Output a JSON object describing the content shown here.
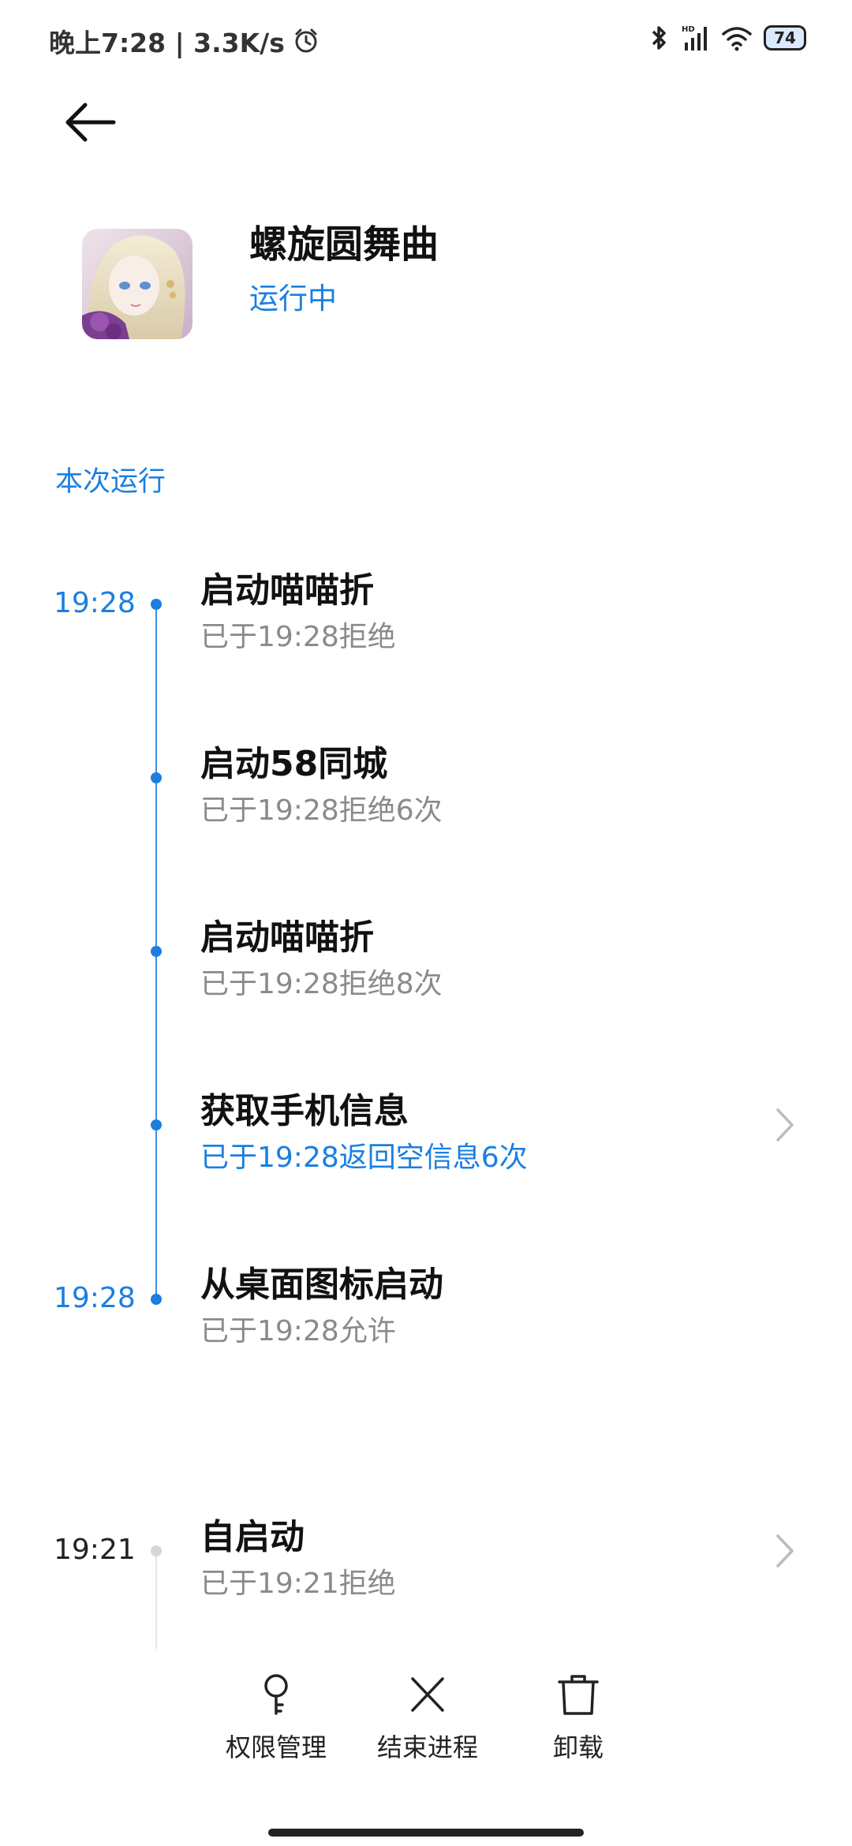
{
  "status_bar": {
    "time": "晚上7:28 | 3.3K/s",
    "battery": "74",
    "icons": [
      "alarm-icon",
      "bluetooth-icon",
      "signal-hd-icon",
      "wifi-icon",
      "battery-icon"
    ]
  },
  "header": {
    "back_icon": "back-arrow-icon"
  },
  "app": {
    "name": "螺旋圆舞曲",
    "status": "运行中"
  },
  "section": {
    "title": "本次运行"
  },
  "timeline": [
    {
      "time": "19:28",
      "title": "启动喵喵折",
      "detail": "已于19:28拒绝"
    },
    {
      "time": "",
      "title": "启动58同城",
      "detail": "已于19:28拒绝6次"
    },
    {
      "time": "",
      "title": "启动喵喵折",
      "detail": "已于19:28拒绝8次"
    },
    {
      "time": "",
      "title": "获取手机信息",
      "detail": "已于19:28返回空信息6次"
    },
    {
      "time": "19:28",
      "title": "从桌面图标启动",
      "detail": "已于19:28允许"
    },
    {
      "time": "19:21",
      "title": "自启动",
      "detail": "已于19:21拒绝"
    }
  ],
  "bottom_actions": {
    "permissions": "权限管理",
    "end_process": "结束进程",
    "uninstall": "卸载"
  },
  "colors": {
    "accent": "#1a7fe0",
    "secondary_text": "#8a8a8a"
  }
}
